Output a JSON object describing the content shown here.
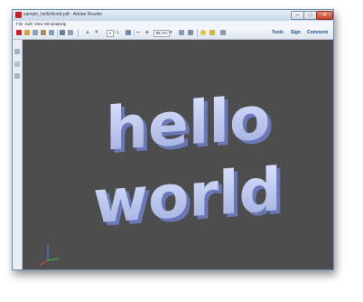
{
  "window": {
    "title": "sample_helloWorld.pdf - Adobe Reader"
  },
  "menu": [
    "File",
    "Edit",
    "View",
    "Window",
    "Help"
  ],
  "toolbar": {
    "page_current": "1",
    "page_total": "/ 1",
    "zoom": "88.1%",
    "tabs": [
      "Tools",
      "Sign",
      "Comment"
    ]
  },
  "scene": {
    "line1": "hello",
    "line2": "world"
  },
  "colors": {
    "viewer_bg": "#4d4d4d",
    "text3d_face": "#b7c3f2",
    "text3d_side": "#6b78b8",
    "accent": "#1a4f8f"
  }
}
